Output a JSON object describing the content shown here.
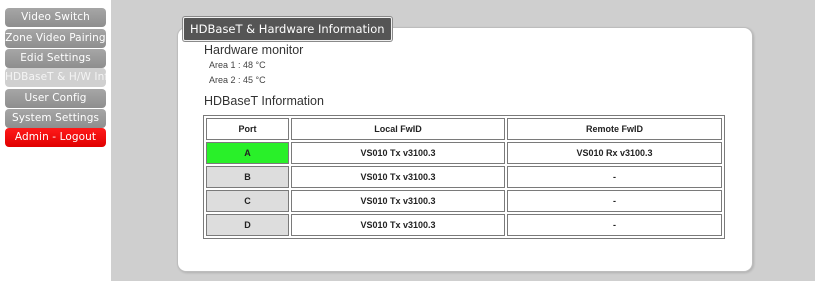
{
  "sidebar": {
    "items": [
      {
        "label": "Video Switch"
      },
      {
        "label": "Zone Video Pairing"
      },
      {
        "label": "Edid Settings"
      },
      {
        "label": "HDBaseT & H/W Info"
      },
      {
        "label": "User Config"
      },
      {
        "label": "System Settings"
      },
      {
        "label": "Admin - Logout"
      }
    ]
  },
  "panel": {
    "title": "HDBaseT & Hardware Information",
    "hardware_monitor": {
      "heading": "Hardware monitor",
      "areas": [
        "Area 1 : 48 °C",
        "Area 2 : 45 °C"
      ]
    },
    "hdbaset": {
      "heading": "HDBaseT Information",
      "columns": [
        "Port",
        "Local FwID",
        "Remote FwID"
      ],
      "rows": [
        {
          "port": "A",
          "local": "VS010 Tx v3100.3",
          "remote": "VS010 Rx v3100.3",
          "port_status_color": "#29f029"
        },
        {
          "port": "B",
          "local": "VS010 Tx v3100.3",
          "remote": "-",
          "port_status_color": "#dddddd"
        },
        {
          "port": "C",
          "local": "VS010 Tx v3100.3",
          "remote": "-",
          "port_status_color": "#dddddd"
        },
        {
          "port": "D",
          "local": "VS010 Tx v3100.3",
          "remote": "-",
          "port_status_color": "#dddddd"
        }
      ]
    }
  },
  "colors": {
    "nav_button": "#9a9a9a",
    "nav_active": "#d0d0d0",
    "logout": "#f20000",
    "tab": "#555555",
    "background": "#cfcfcf"
  }
}
